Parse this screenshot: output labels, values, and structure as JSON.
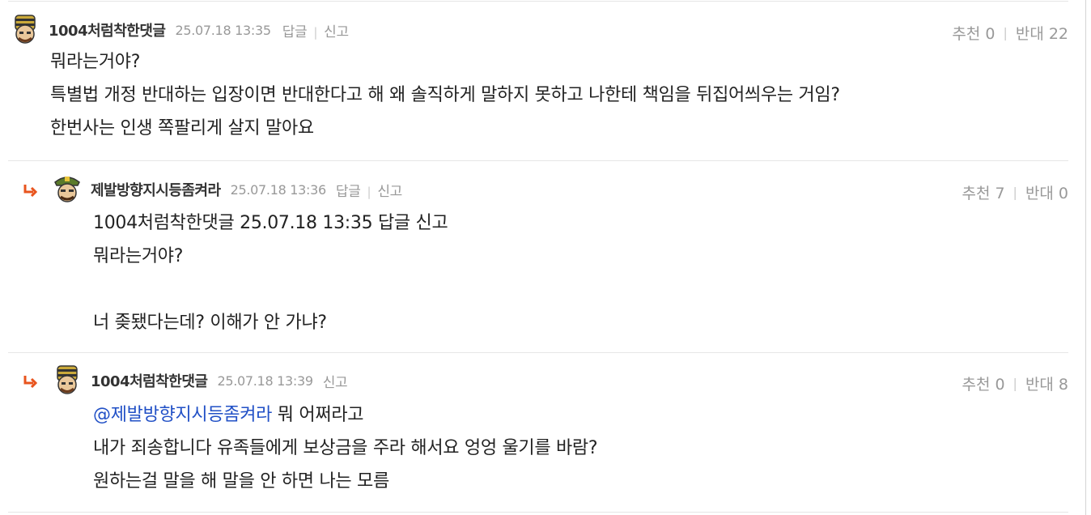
{
  "comments": [
    {
      "author": "1004처럼착한댓글",
      "date": "25.07.18 13:35",
      "reply_label": "답글",
      "report_label": "신고",
      "upvote_label": "추천",
      "upvotes": "0",
      "downvote_label": "반대",
      "downvotes": "22",
      "lines": [
        "뭐라는거야?",
        "특별법 개정 반대하는 입장이면 반대한다고 해 왜 솔직하게 말하지 못하고 나한테 책임을 뒤집어씌우는 거임?",
        "한번사는 인생 쪽팔리게 살지 말아요"
      ]
    },
    {
      "author": "제발방향지시등좀켜라",
      "date": "25.07.18 13:36",
      "reply_label": "답글",
      "report_label": "신고",
      "upvote_label": "추천",
      "upvotes": "7",
      "downvote_label": "반대",
      "downvotes": "0",
      "lines": [
        "1004처럼착한댓글 25.07.18 13:35 답글 신고",
        "뭐라는거야?",
        "",
        "너 좆됐다는데? 이해가 안 가냐?"
      ]
    },
    {
      "author": "1004처럼착한댓글",
      "date": "25.07.18 13:39",
      "report_label": "신고",
      "upvote_label": "추천",
      "upvotes": "0",
      "downvote_label": "반대",
      "downvotes": "8",
      "mention": "@제발방향지시등좀켜라",
      "mention_rest": " 뭐 어쩌라고",
      "lines": [
        "내가 죄송합니다 유족들에게 보상금을 주라 해서요 엉엉 울기를 바람?",
        "원하는걸 말을 해 말을 안 하면 나는 모름"
      ]
    }
  ],
  "colors": {
    "reply_arrow": "#e8541e",
    "mention": "#2150c6",
    "muted": "#999999"
  },
  "icons": [
    "reply-arrow-icon",
    "avatar-icon"
  ]
}
